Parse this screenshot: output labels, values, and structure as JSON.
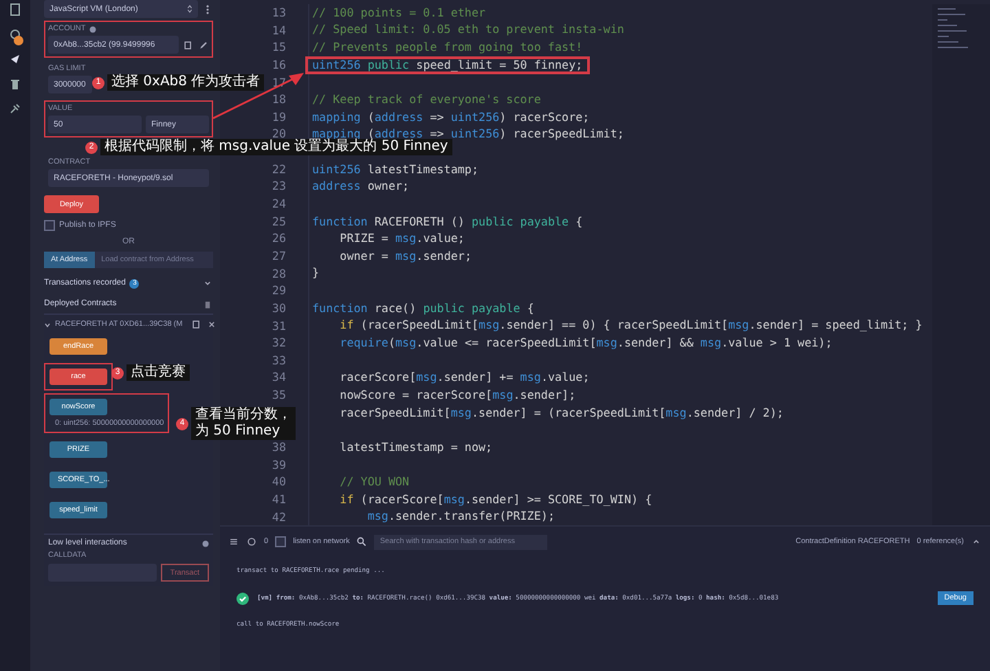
{
  "run_panel": {
    "environment": "JavaScript VM (London)",
    "account": {
      "label": "ACCOUNT",
      "value": "0xAb8...35cb2 (99.9499996",
      "boxed": true
    },
    "gas_limit": {
      "label": "GAS LIMIT",
      "value": "3000000"
    },
    "value": {
      "label": "VALUE",
      "amount": "50",
      "unit": "Finney",
      "boxed": true
    },
    "contract": {
      "label": "CONTRACT",
      "value": "RACEFORETH - Honeypot/9.sol"
    },
    "deploy_button": "Deploy",
    "publish": {
      "label": "Publish to IPFS",
      "checked": false
    },
    "or": "OR",
    "address_tabs": [
      {
        "label": "At Address",
        "selected": true
      },
      {
        "label": "Load contract from Address",
        "selected": false
      }
    ],
    "transactions_recorded": {
      "label": "Transactions recorded",
      "count": "3"
    },
    "deployed_contracts": "Deployed Contracts",
    "instance": {
      "title": "RACEFORETH AT 0XD61...39C38 (M",
      "expanded": true
    },
    "functions": [
      {
        "label": "endRace",
        "kind": "transact",
        "boxed": false
      },
      {
        "label": "race",
        "kind": "payable",
        "boxed": true
      },
      {
        "label": "nowScore",
        "kind": "call",
        "boxed": true,
        "result": "0: uint256: 50000000000000000"
      },
      {
        "label": "PRIZE",
        "kind": "call",
        "boxed": false
      },
      {
        "label": "SCORE_TO_...",
        "kind": "call",
        "boxed": false
      },
      {
        "label": "speed_limit",
        "kind": "call",
        "boxed": false
      }
    ],
    "low_level": {
      "title": "Low level interactions",
      "calldata_label": "CALLDATA",
      "transact_button": "Transact"
    }
  },
  "editor": {
    "lines": [
      {
        "number": "13",
        "boxed": false,
        "tokens": [
          {
            "kind": "comment",
            "text": "// 100 points = 0.1 ether"
          }
        ]
      },
      {
        "number": "14",
        "boxed": false,
        "tokens": [
          {
            "kind": "comment",
            "text": "// Speed limit: 0.05 eth to prevent insta-win"
          }
        ]
      },
      {
        "number": "15",
        "boxed": false,
        "tokens": [
          {
            "kind": "comment",
            "text": "// Prevents people from going too fast!"
          }
        ]
      },
      {
        "number": "16",
        "boxed": true,
        "tokens": [
          {
            "kind": "type",
            "text": "uint256 "
          },
          {
            "kind": "modifier",
            "text": "public"
          },
          {
            "kind": "plain",
            "text": " speed_limit = 50 finney;"
          }
        ]
      },
      {
        "number": "17",
        "boxed": false
      },
      {
        "number": "18",
        "boxed": false,
        "tokens": [
          {
            "kind": "comment",
            "text": "// Keep track of everyone's score"
          }
        ]
      },
      {
        "number": "19",
        "boxed": false,
        "tokens": [
          {
            "kind": "type",
            "text": "mapping"
          },
          {
            "kind": "plain",
            "text": " ("
          },
          {
            "kind": "type",
            "text": "address"
          },
          {
            "kind": "plain",
            "text": " => "
          },
          {
            "kind": "type",
            "text": "uint256"
          },
          {
            "kind": "plain",
            "text": ") racerScore;"
          }
        ]
      },
      {
        "number": "20",
        "boxed": false,
        "tokens": [
          {
            "kind": "type",
            "text": "mapping"
          },
          {
            "kind": "plain",
            "text": " ("
          },
          {
            "kind": "type",
            "text": "address"
          },
          {
            "kind": "plain",
            "text": " => "
          },
          {
            "kind": "type",
            "text": "uint256"
          },
          {
            "kind": "plain",
            "text": ") racerSpeedLimit;"
          }
        ]
      },
      {
        "boxed": false
      },
      {
        "number": "22",
        "boxed": false,
        "tokens": [
          {
            "kind": "type",
            "text": "uint256"
          },
          {
            "kind": "plain",
            "text": " latestTimestamp;"
          }
        ]
      },
      {
        "number": "23",
        "boxed": false,
        "tokens": [
          {
            "kind": "type",
            "text": "address"
          },
          {
            "kind": "plain",
            "text": " owner;"
          }
        ]
      },
      {
        "number": "24",
        "boxed": false
      },
      {
        "number": "25",
        "boxed": false,
        "tokens": [
          {
            "kind": "type",
            "text": "function"
          },
          {
            "kind": "plain",
            "text": " RACEFORETH () "
          },
          {
            "kind": "modifier",
            "text": "public payable"
          },
          {
            "kind": "plain",
            "text": " {"
          }
        ]
      },
      {
        "number": "26",
        "boxed": false,
        "tokens": [
          {
            "kind": "plain",
            "text": "    PRIZE = "
          },
          {
            "kind": "type",
            "text": "msg"
          },
          {
            "kind": "plain",
            "text": ".value;"
          }
        ]
      },
      {
        "number": "27",
        "boxed": false,
        "tokens": [
          {
            "kind": "plain",
            "text": "    owner = "
          },
          {
            "kind": "type",
            "text": "msg"
          },
          {
            "kind": "plain",
            "text": ".sender;"
          }
        ]
      },
      {
        "number": "28",
        "boxed": false,
        "tokens": [
          {
            "kind": "plain",
            "text": "}"
          }
        ]
      },
      {
        "number": "29",
        "boxed": false
      },
      {
        "number": "30",
        "boxed": false,
        "tokens": [
          {
            "kind": "type",
            "text": "function"
          },
          {
            "kind": "plain",
            "text": " race() "
          },
          {
            "kind": "modifier",
            "text": "public payable"
          },
          {
            "kind": "plain",
            "text": " {"
          }
        ]
      },
      {
        "number": "31",
        "boxed": false,
        "tokens": [
          {
            "kind": "control",
            "text": "    if"
          },
          {
            "kind": "plain",
            "text": " (racerSpeedLimit["
          },
          {
            "kind": "type",
            "text": "msg"
          },
          {
            "kind": "plain",
            "text": ".sender] == 0) { racerSpeedLimit["
          },
          {
            "kind": "type",
            "text": "msg"
          },
          {
            "kind": "plain",
            "text": ".sender] = speed_limit; }"
          }
        ]
      },
      {
        "number": "32",
        "boxed": false,
        "tokens": [
          {
            "kind": "type",
            "text": "    require"
          },
          {
            "kind": "plain",
            "text": "("
          },
          {
            "kind": "type",
            "text": "msg"
          },
          {
            "kind": "plain",
            "text": ".value <= racerSpeedLimit["
          },
          {
            "kind": "type",
            "text": "msg"
          },
          {
            "kind": "plain",
            "text": ".sender] && "
          },
          {
            "kind": "type",
            "text": "msg"
          },
          {
            "kind": "plain",
            "text": ".value > 1 wei);"
          }
        ]
      },
      {
        "number": "33",
        "boxed": false
      },
      {
        "number": "34",
        "boxed": false,
        "tokens": [
          {
            "kind": "plain",
            "text": "    racerScore["
          },
          {
            "kind": "type",
            "text": "msg"
          },
          {
            "kind": "plain",
            "text": ".sender] += "
          },
          {
            "kind": "type",
            "text": "msg"
          },
          {
            "kind": "plain",
            "text": ".value;"
          }
        ]
      },
      {
        "number": "35",
        "boxed": false,
        "tokens": [
          {
            "kind": "plain",
            "text": "    nowScore = racerScore["
          },
          {
            "kind": "type",
            "text": "msg"
          },
          {
            "kind": "plain",
            "text": ".sender];"
          }
        ]
      },
      {
        "boxed": false,
        "tokens": [
          {
            "kind": "plain",
            "text": "    racerSpeedLimit["
          },
          {
            "kind": "type",
            "text": "msg"
          },
          {
            "kind": "plain",
            "text": ".sender] = (racerSpeedLimit["
          },
          {
            "kind": "type",
            "text": "msg"
          },
          {
            "kind": "plain",
            "text": ".sender] / 2);"
          }
        ]
      },
      {
        "boxed": false
      },
      {
        "number": "38",
        "boxed": false,
        "tokens": [
          {
            "kind": "plain",
            "text": "    latestTimestamp = now;"
          }
        ]
      },
      {
        "number": "39",
        "boxed": false
      },
      {
        "number": "40",
        "boxed": false,
        "tokens": [
          {
            "kind": "comment",
            "text": "    // YOU WON"
          }
        ]
      },
      {
        "number": "41",
        "boxed": false,
        "tokens": [
          {
            "kind": "control",
            "text": "    if"
          },
          {
            "kind": "plain",
            "text": " (racerScore["
          },
          {
            "kind": "type",
            "text": "msg"
          },
          {
            "kind": "plain",
            "text": ".sender] >= SCORE_TO_WIN) {"
          }
        ]
      },
      {
        "number": "42",
        "boxed": false,
        "tokens": [
          {
            "kind": "type",
            "text": "        msg"
          },
          {
            "kind": "plain",
            "text": ".sender.transfer(PRIZE);"
          }
        ]
      }
    ]
  },
  "annotations": [
    {
      "number": "1",
      "text": "选择 0xAb8 作为攻击者"
    },
    {
      "number": "2",
      "text": "根据代码限制，将 msg.value 设置为最大的 50 Finney"
    },
    {
      "number": "3",
      "text": "点击竞赛"
    },
    {
      "number": "4",
      "text": "查看当前分数，为 50 Finney"
    }
  ],
  "terminal": {
    "pending_count": "0",
    "listen": {
      "label": "listen on network",
      "checked": false
    },
    "search": {
      "placeholder": "Search with transaction hash or address"
    },
    "definition": "ContractDefinition RACEFORETH",
    "references": "0 reference(s)",
    "logs": [
      {
        "kind": "info",
        "text": "transact to RACEFORETH.race pending ..."
      },
      {
        "kind": "tx",
        "text": "**[vm]** **from:** 0xAb8...35cb2 **to:** RACEFORETH.race() 0xd61...39C38 **value:** 50000000000000000 wei **data:** 0xd01...5a77a **logs:** 0 **hash:** 0x5d8...01e83",
        "button": "Debug"
      },
      {
        "kind": "info",
        "text": "call to RACEFORETH.nowScore"
      }
    ]
  }
}
